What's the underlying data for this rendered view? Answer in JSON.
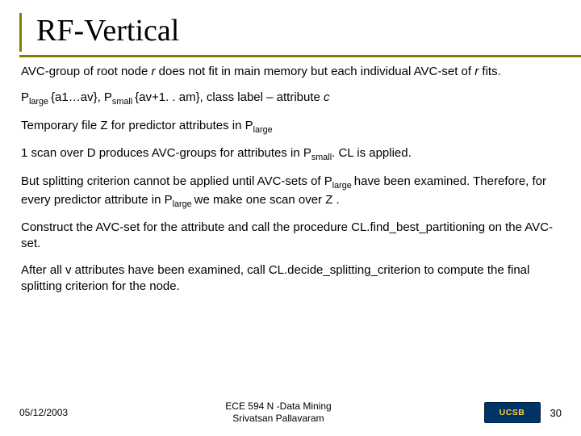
{
  "title": "RF-Vertical",
  "body": {
    "p1_a": "AVC-group of root node ",
    "p1_r": "r",
    "p1_b": " does not fit in main memory but each individual AVC-set of ",
    "p1_r2": "r",
    "p1_c": "  fits.",
    "p2_a": "P",
    "p2_sub1": "large ",
    "p2_b": "{a1…av}, P",
    "p2_sub2": "small ",
    "p2_c": "{av+1. . am}, class label – attribute ",
    "p2_d": "c",
    "p3_a": "Temporary file Z for predictor attributes in P",
    "p3_sub": "large",
    "p4_a": "1 scan over D produces AVC-groups for attributes in P",
    "p4_sub": "small",
    "p4_b": ".  CL is applied.",
    "p5_a": "But splitting criterion cannot be applied until AVC-sets of P",
    "p5_sub1": "large ",
    "p5_b": "have been examined.  Therefore, for every predictor attribute in P",
    "p5_sub2": "large  ",
    "p5_c": "we make one scan over Z .",
    "p6": "Construct the AVC-set for the attribute and call the procedure CL.find_best_partitioning on the AVC-set.",
    "p7": "After all v attributes have been examined, call CL.decide_splitting_criterion to compute the final splitting criterion for the node."
  },
  "footer": {
    "date": "05/12/2003",
    "center_line1": "ECE 594 N -Data Mining",
    "center_line2": "Srivatsan Pallavaram",
    "logo_text": "UCSB",
    "slide_number": "30"
  }
}
